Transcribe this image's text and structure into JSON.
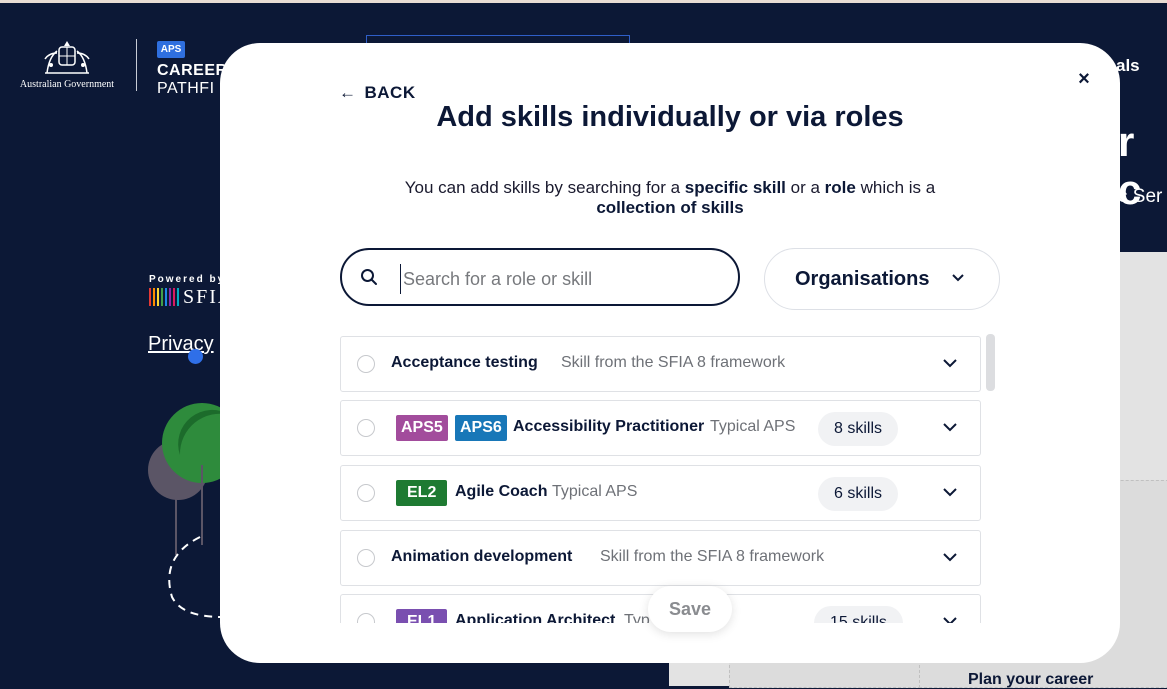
{
  "background": {
    "gov_name": "Australian Government",
    "aps_badge": "APS",
    "brand_line1": "CAREER",
    "brand_line2": "PATHFI",
    "nav_fragment": "als",
    "hero_fragment": "r c",
    "hero_sub_fragment": "c Ser",
    "powered_by": "Powered by",
    "sfia_logo": "SFIA",
    "privacy_link": "Privacy",
    "plan_text": "Plan your career"
  },
  "modal": {
    "back_label": "BACK",
    "close_label": "×",
    "title": "Add skills individually or via roles",
    "subtitle_part1": "You can add skills by searching for a ",
    "subtitle_bold1": "specific skill",
    "subtitle_part2": " or a ",
    "subtitle_bold2": "role",
    "subtitle_part3": " which is a ",
    "subtitle_bold3": "collection of skills",
    "search_placeholder": "Search for a role or skill",
    "search_value": "",
    "org_button_label": "Organisations",
    "save_label": "Save",
    "items": [
      {
        "name": "Acceptance testing",
        "desc": "Skill from the SFIA 8 framework",
        "badges": [],
        "skills": ""
      },
      {
        "name": "Accessibility Practitioner",
        "desc": "Typical APS",
        "badges": [
          "APS5",
          "APS6"
        ],
        "skills": "8 skills"
      },
      {
        "name": "Agile Coach",
        "desc": "Typical APS",
        "badges": [
          "EL2"
        ],
        "skills": "6 skills"
      },
      {
        "name": "Animation development",
        "desc": "Skill from the SFIA 8 framework",
        "badges": [],
        "skills": ""
      },
      {
        "name": "Application Architect",
        "desc": "Typ",
        "badges": [
          "EL1"
        ],
        "skills": "15 skills"
      }
    ]
  },
  "colors": {
    "navy": "#0c1836",
    "aps5": "#a24c9c",
    "aps6": "#1877b8",
    "el2": "#1e7a32",
    "el1": "#7a4fb0"
  }
}
